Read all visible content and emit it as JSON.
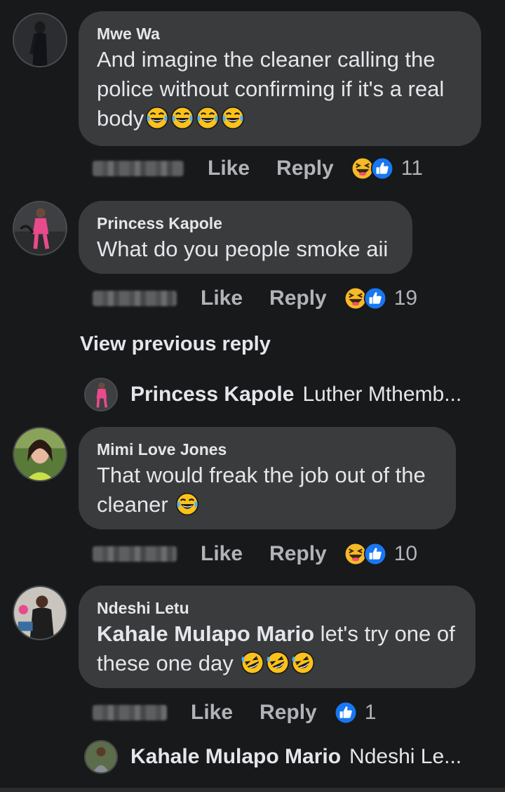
{
  "comments": [
    {
      "author": "Mwe Wa",
      "text": "And imagine the cleaner calling the police without confirming if it's a real body",
      "emojis": [
        "laughing-tears",
        "laughing-tears",
        "laughing-tears",
        "laughing-tears"
      ],
      "like_label": "Like",
      "reply_label": "Reply",
      "reactions": [
        "haha",
        "like"
      ],
      "reaction_count": "11"
    },
    {
      "author": "Princess Kapole",
      "text": "What do you people smoke aii",
      "emojis": [],
      "like_label": "Like",
      "reply_label": "Reply",
      "reactions": [
        "haha",
        "like"
      ],
      "reaction_count": "19"
    },
    {
      "author": "Mimi Love Jones",
      "text": "That would freak the job out of the cleaner",
      "emojis": [
        "laughing-tears"
      ],
      "like_label": "Like",
      "reply_label": "Reply",
      "reactions": [
        "haha",
        "like"
      ],
      "reaction_count": "10"
    },
    {
      "author": "Ndeshi Letu",
      "mention": "Kahale Mulapo Mario",
      "text": "let's try one of these one day",
      "emojis": [
        "rolling-laughing",
        "rolling-laughing",
        "rolling-laughing"
      ],
      "like_label": "Like",
      "reply_label": "Reply",
      "reactions": [
        "like"
      ],
      "reaction_count": "1"
    }
  ],
  "view_previous_reply": "View previous reply",
  "reply_previews": [
    {
      "name": "Princess Kapole",
      "snippet": "Luther Mthemb..."
    },
    {
      "name": "Kahale Mulapo Mario",
      "snippet": "Ndeshi Le..."
    }
  ],
  "colors": {
    "background": "#18191a",
    "bubble": "#3a3b3c",
    "text_primary": "#e4e6eb",
    "text_secondary": "#b0b3b8",
    "like_blue": "#1877f2",
    "haha_yellow": "#f7b928"
  }
}
